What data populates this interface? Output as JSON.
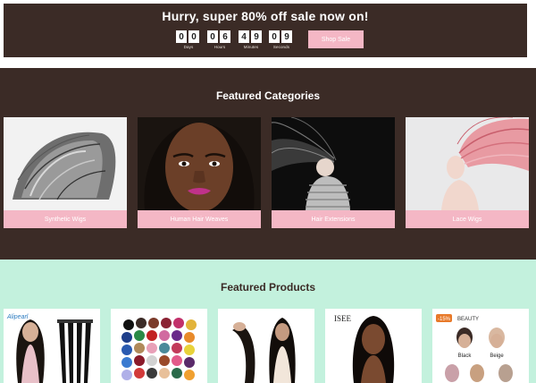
{
  "sale": {
    "title": "Hurry, super 80% off sale now on!",
    "timer": [
      {
        "d1": "0",
        "d2": "0",
        "label": "Days"
      },
      {
        "d1": "0",
        "d2": "6",
        "label": "Hours"
      },
      {
        "d1": "4",
        "d2": "9",
        "label": "Minutes"
      },
      {
        "d1": "0",
        "d2": "9",
        "label": "Seconds"
      }
    ],
    "button_label": "Shop Sale"
  },
  "categories": {
    "title": "Featured Categories",
    "items": [
      {
        "label": "Synthetic Wigs"
      },
      {
        "label": "Human Hair Weaves"
      },
      {
        "label": "Hair Extensions"
      },
      {
        "label": "Lace Wigs"
      }
    ]
  },
  "products": {
    "title": "Featured Products",
    "items": [
      {
        "brand": "Alipearl"
      },
      {
        "brand": ""
      },
      {
        "brand": ""
      },
      {
        "brand": "ISEE"
      },
      {
        "badge": "-15%",
        "brand": "BEAUTY",
        "color1": "Black",
        "color2": "Beige"
      }
    ]
  },
  "colors": {
    "dark_brown": "#3b2b26",
    "pink": "#f4b7c5",
    "mint": "#c3f1dd"
  }
}
